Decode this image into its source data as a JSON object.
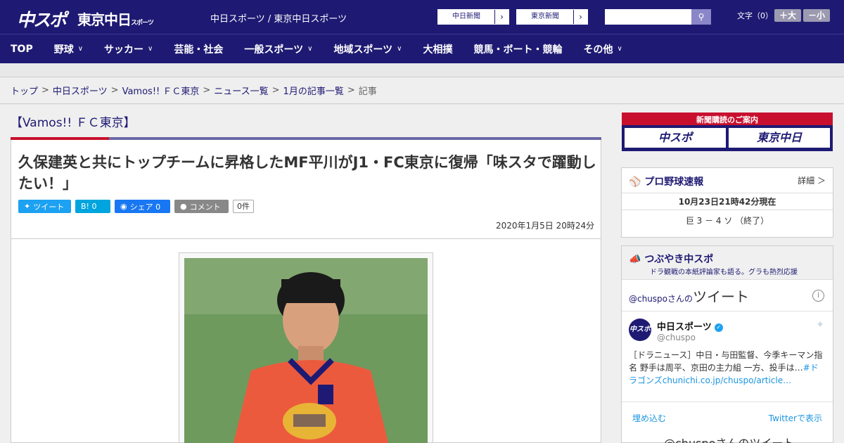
{
  "header": {
    "logo_chuspo": "中スポ",
    "logo_tokyo": "東京中日",
    "logo_tokyo_small": "スポーツ",
    "tagline": "中日スポーツ / 東京中日スポーツ",
    "paper_links": [
      "中日新聞",
      "東京新聞"
    ],
    "search_placeholder": "",
    "font_size_label": "文字（0）",
    "font_plus": "＋大",
    "font_minus": "－小"
  },
  "nav": {
    "items": [
      {
        "label": "TOP",
        "has_dropdown": false
      },
      {
        "label": "野球",
        "has_dropdown": true
      },
      {
        "label": "サッカー",
        "has_dropdown": true
      },
      {
        "label": "芸能・社会",
        "has_dropdown": false
      },
      {
        "label": "一般スポーツ",
        "has_dropdown": true
      },
      {
        "label": "地域スポーツ",
        "has_dropdown": true
      },
      {
        "label": "大相撲",
        "has_dropdown": false
      },
      {
        "label": "競馬・ボート・競輪",
        "has_dropdown": false
      },
      {
        "label": "その他",
        "has_dropdown": true
      }
    ]
  },
  "breadcrumb": {
    "items": [
      "トップ",
      "中日スポーツ",
      "Vamos!! ＦＣ東京",
      "ニュース一覧",
      "1月の記事一覧"
    ],
    "current": "記事"
  },
  "article": {
    "section": "【Vamos!! ＦＣ東京】",
    "headline": "久保建英と共にトップチームに昇格したMF平川がJ1・FC東京に復帰「味スタで躍動したい！」",
    "share": {
      "twitter": "ツイート",
      "hatena": "B! 0",
      "facebook": "シェア 0",
      "comment": "コメント",
      "comment_count": "0件"
    },
    "date": "2020年1月5日 20時24分"
  },
  "sidebar": {
    "subscribe_title": "新聞購読のご案内",
    "subscribe_chuspo": "中スポ",
    "subscribe_tokyo": "東京中日",
    "baseball": {
      "title": "プロ野球速報",
      "detail": "詳細 ＞",
      "time": "10月23日21時42分現在",
      "score": "巨 3 － 4 ソ （終了）"
    },
    "tweets": {
      "title": "つぶやき中スポ",
      "subtitle": "ドラ観戦の本紙評論家も語る。グラも熱烈応援",
      "heading_handle": "@chuspoさんの",
      "heading_big": "ツイート",
      "author_name": "中日スポーツ",
      "author_handle": "@chuspo",
      "avatar": "中スポ",
      "body": "［ドラニュース］中日・与田監督、今季キーマン指名 野手は周平、京田の主力組 一方、投手は…",
      "body_link": "#ドラゴンズchunichi.co.jp/chuspo/article…",
      "embed": "埋め込む",
      "view": "Twitterで表示",
      "bottom": "@chuspoさんのツイート"
    }
  }
}
